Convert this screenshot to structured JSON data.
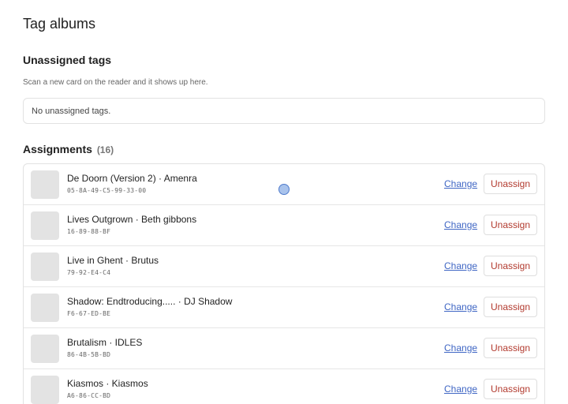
{
  "page": {
    "title": "Tag albums"
  },
  "unassigned": {
    "heading": "Unassigned tags",
    "helper": "Scan a new card on the reader and it shows up here.",
    "empty_message": "No unassigned tags."
  },
  "assignments": {
    "heading": "Assignments",
    "count": "(16)",
    "change_label": "Change",
    "unassign_label": "Unassign",
    "rows": [
      {
        "title": "De Doorn (Version 2) · Amenra",
        "uid": "05-8A-49-C5-99-33-00"
      },
      {
        "title": "Lives Outgrown · Beth gibbons",
        "uid": "16-89-88-BF"
      },
      {
        "title": "Live in Ghent · Brutus",
        "uid": "79-92-E4-C4"
      },
      {
        "title": "Shadow: Endtroducing..... · DJ Shadow",
        "uid": "F6-67-ED-BE"
      },
      {
        "title": "Brutalism · IDLES",
        "uid": "86-4B-5B-BD"
      },
      {
        "title": "Kiasmos · Kiasmos",
        "uid": "A6-86-CC-BD"
      }
    ]
  },
  "colors": {
    "link": "#3f66c4",
    "danger": "#b23a2e",
    "cursor": "#a9c3ec"
  }
}
